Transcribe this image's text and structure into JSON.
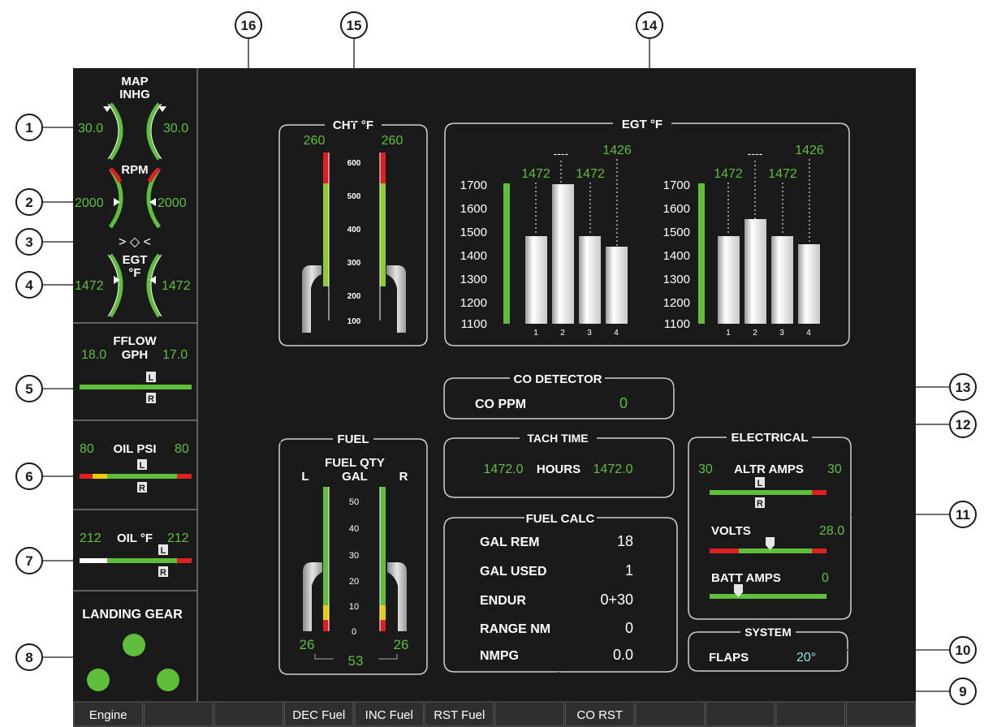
{
  "callouts": [
    "1",
    "2",
    "3",
    "4",
    "5",
    "6",
    "7",
    "8",
    "9",
    "10",
    "11",
    "12",
    "13",
    "14",
    "15",
    "16"
  ],
  "left_strip": {
    "map": {
      "title1": "MAP",
      "title2": "INHG",
      "left": "30.0",
      "right": "30.0"
    },
    "rpm": {
      "title": "RPM",
      "left": "2000",
      "right": "2000"
    },
    "sync": {
      "glyph": "> ◇ <"
    },
    "egt": {
      "title1": "EGT",
      "title2": "°F",
      "left": "1472",
      "right": "1472"
    },
    "fflow": {
      "title1": "FFLOW",
      "title2": "GPH",
      "left": "18.0",
      "right": "17.0",
      "marker_left": "L",
      "marker_right": "R"
    },
    "oil_psi": {
      "title": "OIL PSI",
      "left": "80",
      "right": "80",
      "marker_left": "L",
      "marker_right": "R"
    },
    "oil_temp": {
      "title": "OIL °F",
      "left": "212",
      "right": "212",
      "marker_left": "L",
      "marker_right": "R"
    },
    "landing_gear": {
      "title": "LANDING GEAR"
    }
  },
  "cht": {
    "title": "CHT °F",
    "left_value": "260",
    "right_value": "260",
    "ticks": [
      "600",
      "500",
      "400",
      "300",
      "200",
      "100"
    ]
  },
  "egt_panel": {
    "title": "EGT °F",
    "left": {
      "top_value": "1426",
      "dash": "----",
      "v1": "1472",
      "v2": "1472",
      "ticks": [
        "1700",
        "1600",
        "1500",
        "1400",
        "1300",
        "1200",
        "1100"
      ],
      "bars": [
        "1",
        "2",
        "3",
        "4"
      ]
    },
    "right": {
      "top_value": "1426",
      "dash": "----",
      "v1": "1472",
      "v2": "1472",
      "ticks": [
        "1700",
        "1600",
        "1500",
        "1400",
        "1300",
        "1200",
        "1100"
      ],
      "bars": [
        "1",
        "2",
        "3",
        "4"
      ]
    }
  },
  "co_detector": {
    "title": "CO DETECTOR",
    "label": "CO PPM",
    "value": "0"
  },
  "tach_time": {
    "title": "TACH TIME",
    "left": "1472.0",
    "label": "HOURS",
    "right": "1472.0"
  },
  "fuel": {
    "title": "FUEL",
    "qty": "FUEL QTY",
    "gal": "GAL",
    "l": "L",
    "r": "R",
    "ticks": [
      "50",
      "40",
      "30",
      "20",
      "10",
      "0"
    ],
    "left_value": "26",
    "right_value": "26",
    "total": "53"
  },
  "fuel_calc": {
    "title": "FUEL CALC",
    "rows": [
      {
        "label": "GAL REM",
        "value": "18"
      },
      {
        "label": "GAL USED",
        "value": "1"
      },
      {
        "label": "ENDUR",
        "value": "0+30"
      },
      {
        "label": "RANGE NM",
        "value": "0"
      },
      {
        "label": "NMPG",
        "value": "0.0"
      }
    ]
  },
  "electrical": {
    "title": "ELECTRICAL",
    "altr": {
      "label": "ALTR AMPS",
      "left": "30",
      "right": "30",
      "marker_left": "L",
      "marker_right": "R"
    },
    "volts": {
      "label": "VOLTS",
      "value": "28.0"
    },
    "batt": {
      "label": "BATT AMPS",
      "value": "0"
    }
  },
  "system": {
    "title": "SYSTEM",
    "label": "FLAPS",
    "value": "20°"
  },
  "softkeys": [
    "Engine",
    "",
    "",
    "DEC Fuel",
    "INC Fuel",
    "RST Fuel",
    "",
    "CO RST",
    "",
    "",
    "",
    ""
  ],
  "colors": {
    "green": "#5fbf3a",
    "red": "#e02020",
    "yellow": "#e8d000",
    "cyan": "#8fe0e0",
    "panel": "#1a1a1a"
  }
}
